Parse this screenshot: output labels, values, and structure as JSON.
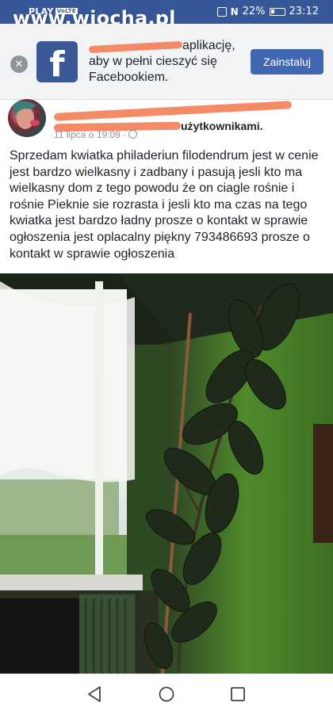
{
  "status_bar": {
    "carrier": "PLAY",
    "network_badge": "VoLTE",
    "battery": "22%",
    "time": "23:12",
    "icons": [
      "vibrate-icon",
      "nfc-icon",
      "battery-icon"
    ]
  },
  "watermark": "www.wiocha.pl",
  "app_banner": {
    "text_visible": "aplikację, aby w pełni cieszyć się Facebookiem.",
    "install_label": "Zainstaluj",
    "close_icon": "close-icon",
    "logo_glyph": "f"
  },
  "post": {
    "author_visible": "użytkownikami.",
    "timestamp": "11 lipca o 19:09 ·",
    "privacy_icon": "globe-icon",
    "text": "Sprzedam kwiatka philaderiun filodendrum jest w cenie jest bardzo wielkasny i zadbany i pasują jesli kto ma wielkasny dom z tego powodu że on ciagle rośnie i rośnie Pieknie sie rozrasta i jesli kto ma czas na tego kwiatka jest bardzo ładny prosze o kontakt w sprawie ogłoszenia jest oplacalny piękny 793486693 prosze o kontakt w sprawie ogłoszenia",
    "photo": "photo of a tall rubber plant next to a window in a green room"
  },
  "nav_bar": {
    "back_icon": "back-triangle-icon",
    "home_icon": "home-circle-icon",
    "recents_icon": "recents-square-icon"
  },
  "colors": {
    "status_bar": "#365899",
    "facebook_blue": "#3b5998",
    "install_button": "#4267b2",
    "banner_bg": "#f2f3f5",
    "redaction": "#f4845f",
    "wall_green": "#4f8a2b"
  }
}
